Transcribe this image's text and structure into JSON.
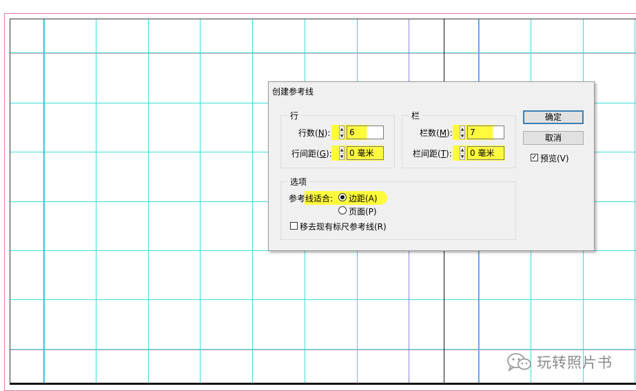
{
  "dialog": {
    "title": "创建参考线",
    "rows_group": {
      "label": "行",
      "count_label": "行数(",
      "count_key": "N",
      "count_suffix": "):",
      "count_value": "6",
      "gutter_label": "行间距(",
      "gutter_key": "G",
      "gutter_suffix": "):",
      "gutter_value": "0 毫米"
    },
    "columns_group": {
      "label": "栏",
      "count_label": "栏数(",
      "count_key": "M",
      "count_suffix": "):",
      "count_value": "7",
      "gutter_label": "栏间距(",
      "gutter_key": "T",
      "gutter_suffix": "):",
      "gutter_value": "0 毫米"
    },
    "options_group": {
      "label": "选项",
      "fit_label": "参考线适合:",
      "fit_options": [
        {
          "label": "边距(A)",
          "selected": true
        },
        {
          "label": "页面(P)",
          "selected": false
        }
      ],
      "remove_label": "移去现有标尺参考线(R)",
      "remove_checked": false
    },
    "ok_label": "确定",
    "cancel_label": "取消",
    "preview_label": "预览(V)",
    "preview_checked": true
  },
  "watermark": {
    "text": "玩转照片书",
    "icon": "wechat-icon"
  },
  "colors": {
    "guide": "#39dcdc",
    "margin_guide": "#8b7fd6",
    "highlight": "#fffa3c",
    "dialog_bg": "#f0f0f0"
  }
}
